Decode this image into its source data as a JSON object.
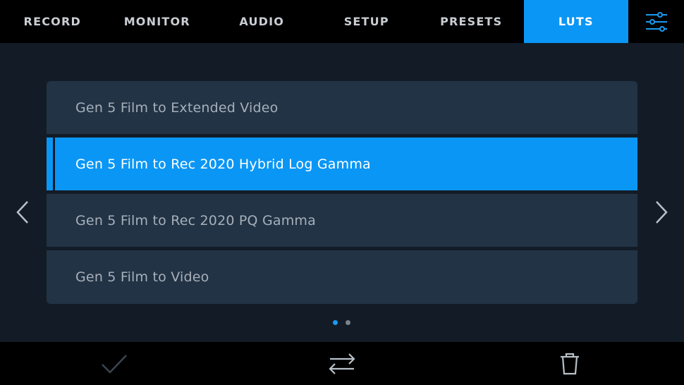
{
  "tabs": [
    {
      "label": "RECORD"
    },
    {
      "label": "MONITOR"
    },
    {
      "label": "AUDIO"
    },
    {
      "label": "SETUP"
    },
    {
      "label": "PRESETS"
    },
    {
      "label": "LUTS",
      "active": true
    }
  ],
  "menu_icon": "sliders-icon",
  "luts": {
    "items": [
      {
        "label": "Gen 5 Film to Extended Video"
      },
      {
        "label": "Gen 5 Film to Rec 2020 Hybrid Log Gamma",
        "selected": true
      },
      {
        "label": "Gen 5 Film to Rec 2020 PQ Gamma"
      },
      {
        "label": "Gen 5 Film to Video"
      }
    ]
  },
  "pagination": {
    "current": 1,
    "total": 2
  },
  "toolbar": {
    "icons": [
      "checkmark-icon",
      "swap-arrows-icon",
      "trash-icon"
    ]
  },
  "colors": {
    "accent": "#0a96f5",
    "background": "#131c26",
    "row": "#223345",
    "bar": "#000000"
  }
}
